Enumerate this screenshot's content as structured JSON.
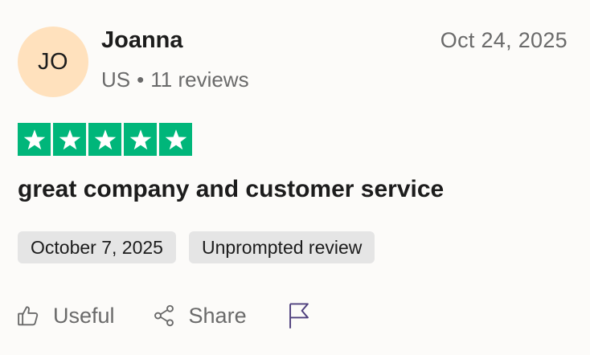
{
  "reviewer": {
    "initials": "JO",
    "name": "Joanna",
    "country": "US",
    "separator": "•",
    "review_count": "11 reviews"
  },
  "review": {
    "posted_date": "Oct 24, 2025",
    "rating": 5,
    "rating_max": 5,
    "title": "great company and customer service",
    "experience_date": "October 7, 2025",
    "type_tag": "Unprompted review"
  },
  "actions": {
    "useful_label": "Useful",
    "share_label": "Share"
  },
  "colors": {
    "star_green": "#00b67a",
    "avatar_bg": "#ffe1bd",
    "muted_text": "#6a6a6a",
    "flag_icon": "#4e3f7d"
  },
  "icons": {
    "star": "star-icon",
    "useful": "thumbs-up-icon",
    "share": "share-icon",
    "report": "flag-icon"
  }
}
